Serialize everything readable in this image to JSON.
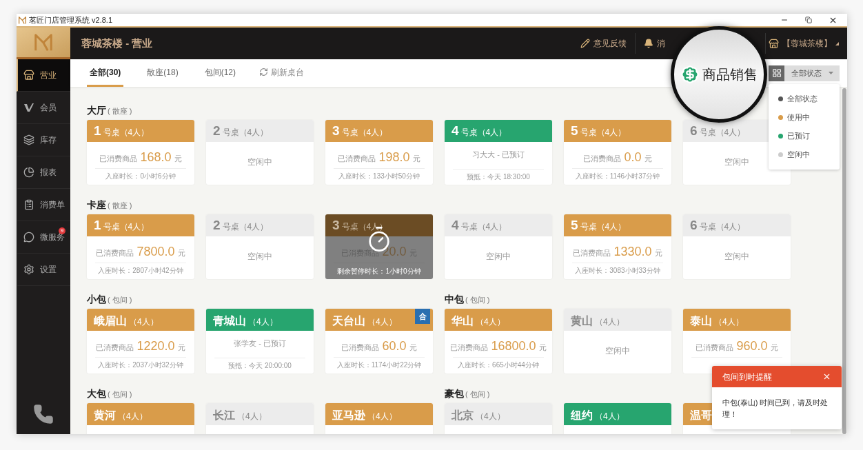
{
  "window": {
    "title": "茗匠门店管理系统 v2.8.1"
  },
  "header": {
    "title": "蓉城茶楼 - 营业",
    "actions": [
      {
        "label": "意见反馈"
      },
      {
        "label": "消"
      },
      {
        "label": "【蓉城茶楼】"
      }
    ]
  },
  "magnifier": {
    "label": "商品销售"
  },
  "sidebar": {
    "items": [
      {
        "label": "营业",
        "selected": true
      },
      {
        "label": "会员",
        "selected": false
      },
      {
        "label": "库存",
        "selected": false
      },
      {
        "label": "报表",
        "selected": false
      },
      {
        "label": "消费单",
        "selected": false
      },
      {
        "label": "微服务",
        "selected": false,
        "badge": "9"
      },
      {
        "label": "设置",
        "selected": false
      }
    ]
  },
  "tabs": [
    {
      "label": "全部(30)",
      "selected": true
    },
    {
      "label": "散座(18)",
      "selected": false
    },
    {
      "label": "包间(12)",
      "selected": false
    }
  ],
  "refresh": {
    "label": "刷新桌台"
  },
  "status_filter": {
    "value": "全部状态",
    "options": [
      {
        "label": "全部状态",
        "color": "#555555"
      },
      {
        "label": "使用中",
        "color": "#d99c4a"
      },
      {
        "label": "已预订",
        "color": "#27a56f"
      },
      {
        "label": "空闲中",
        "color": "#cccccc"
      }
    ]
  },
  "sections": [
    {
      "title": "大厅",
      "subtitle": "( 散座 )",
      "kind": "seats",
      "tables": [
        {
          "name": "1",
          "label": "号桌（4人）",
          "kind": "in_use",
          "paused": false,
          "spent_label": "已消费商品",
          "amount": "168.0",
          "unit": "元",
          "duration": "入座时长：0小时6分钟"
        },
        {
          "name": "2",
          "label": "号桌（4人）",
          "kind": "idle",
          "paused": false,
          "state_text": "空闲中"
        },
        {
          "name": "3",
          "label": "号桌（4人）",
          "kind": "in_use",
          "paused": false,
          "spent_label": "已消费商品",
          "amount": "198.0",
          "unit": "元",
          "duration": "入座时长：133小时50分钟"
        },
        {
          "name": "4",
          "label": "号桌（4人）",
          "kind": "reserved",
          "paused": false,
          "guest": "习大大 - 已预订",
          "arrival": "预抵：今天 18:30:00"
        },
        {
          "name": "5",
          "label": "号桌（4人）",
          "kind": "in_use",
          "paused": false,
          "spent_label": "已消费商品",
          "amount": "0.0",
          "unit": "元",
          "duration": "入座时长：1146小时37分钟"
        },
        {
          "name": "6",
          "label": "号桌（4人）",
          "kind": "idle",
          "paused": false,
          "state_text": "空闲中"
        }
      ]
    },
    {
      "title": "卡座",
      "subtitle": "( 散座 )",
      "kind": "seats",
      "tables": [
        {
          "name": "1",
          "label": "号桌（4人）",
          "kind": "in_use",
          "paused": false,
          "spent_label": "已消费商品",
          "amount": "7800.0",
          "unit": "元",
          "duration": "入座时长：2807小时42分钟"
        },
        {
          "name": "2",
          "label": "号桌（4人）",
          "kind": "idle",
          "paused": false,
          "state_text": "空闲中"
        },
        {
          "name": "3",
          "label": "号桌（4人）",
          "kind": "in_use",
          "paused": true,
          "pause_text": "剩余暂停时长：1小时0分钟",
          "spent_label": "已消费商品",
          "amount": "20.0",
          "unit": "元"
        },
        {
          "name": "4",
          "label": "号桌（4人）",
          "kind": "idle",
          "paused": false,
          "state_text": "空闲中"
        },
        {
          "name": "5",
          "label": "号桌（4人）",
          "kind": "in_use",
          "paused": false,
          "spent_label": "已消费商品",
          "amount": "1330.0",
          "unit": "元",
          "duration": "入座时长：3083小时33分钟"
        },
        {
          "name": "6",
          "label": "号桌（4人）",
          "kind": "idle",
          "paused": false,
          "state_text": "空闲中"
        }
      ]
    },
    {
      "title": "小包",
      "subtitle": "( 包间 )",
      "kind": "rooms",
      "tables": [
        {
          "name": "峨眉山",
          "label": "（4人）",
          "kind": "in_use",
          "paused": false,
          "spent_label": "已消费商品",
          "amount": "1220.0",
          "unit": "元",
          "duration": "入座时长：2037小时32分钟"
        },
        {
          "name": "青城山",
          "label": "（4人）",
          "kind": "reserved",
          "paused": false,
          "guest": "张学友 - 已预订",
          "arrival": "预抵：今天 20:00:00"
        },
        {
          "name": "天台山",
          "label": "（4人）",
          "kind": "in_use",
          "paused": false,
          "badge": "合",
          "spent_label": "已消费商品",
          "amount": "60.0",
          "unit": "元",
          "duration": "入座时长：1174小时22分钟"
        }
      ]
    },
    {
      "title": "中包",
      "subtitle": "( 包间 )",
      "kind": "rooms",
      "tables": [
        {
          "name": "华山",
          "label": "（4人）",
          "kind": "in_use",
          "paused": false,
          "spent_label": "已消费商品",
          "amount": "16800.0",
          "unit": "元",
          "duration": "入座时长：665小时44分钟"
        },
        {
          "name": "黄山",
          "label": "（4人）",
          "kind": "idle",
          "paused": false,
          "state_text": "空闲中"
        },
        {
          "name": "泰山",
          "label": "（4人）",
          "kind": "in_use",
          "paused": false,
          "spent_label": "已消费商品",
          "amount": "960.0",
          "unit": "元"
        }
      ]
    },
    {
      "title": "大包",
      "subtitle": "( 包间 )",
      "kind": "rooms",
      "tables": [
        {
          "name": "黄河",
          "label": "（4人）",
          "kind": "in_use",
          "paused": false
        },
        {
          "name": "长江",
          "label": "（4人）",
          "kind": "idle",
          "paused": false
        },
        {
          "name": "亚马逊",
          "label": "（4人）",
          "kind": "in_use",
          "paused": false
        }
      ]
    },
    {
      "title": "豪包",
      "subtitle": "( 包间 )",
      "kind": "rooms",
      "tables": [
        {
          "name": "北京",
          "label": "（4人）",
          "kind": "idle",
          "paused": false
        },
        {
          "name": "纽约",
          "label": "（4人）",
          "kind": "reserved",
          "paused": false
        },
        {
          "name": "温哥",
          "kind": "in_use",
          "paused": false
        }
      ]
    }
  ],
  "toast": {
    "title": "包间到时提醒",
    "message": "中包(泰山) 时间已到，请及时处理！"
  }
}
